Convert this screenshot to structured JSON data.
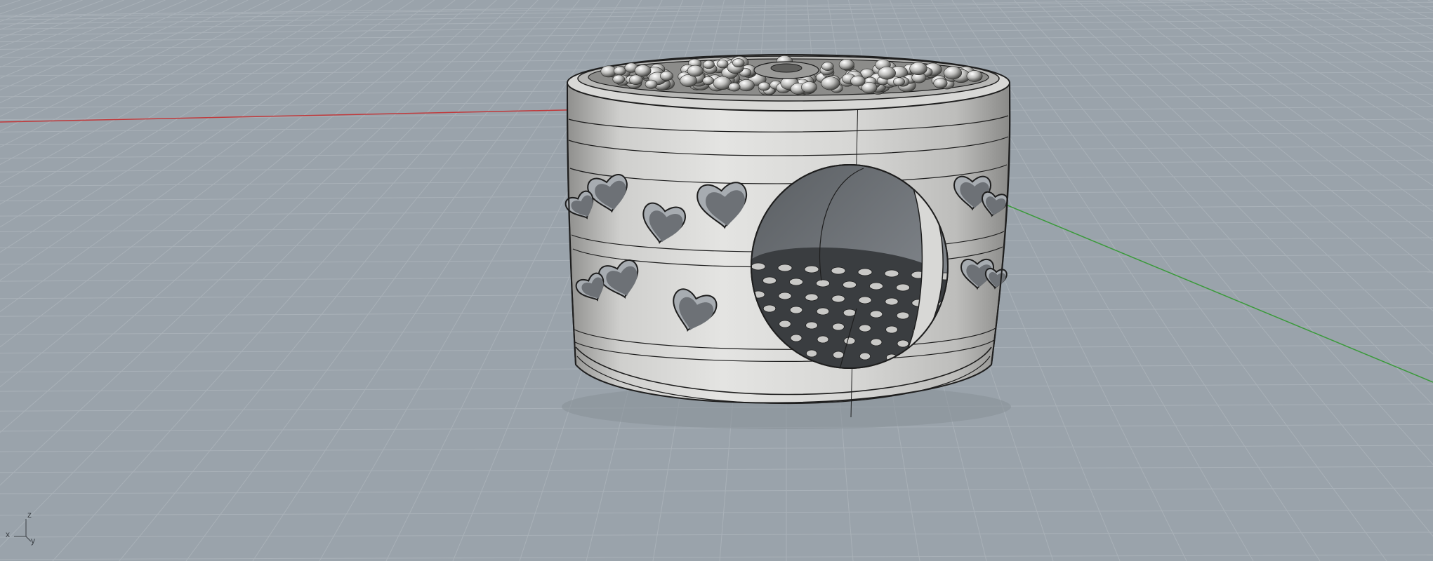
{
  "viewport": {
    "background_color": "#9aa3ab",
    "grid_color": "#a9b1b8",
    "x_axis_color": "#c0393b",
    "y_axis_color": "#3a9a3a"
  },
  "model": {
    "name": "ring-model",
    "body_color": "#c9c9c7",
    "edge_color": "#1e1e1e",
    "cutout_shape": "heart"
  },
  "axis_indicator": {
    "x_label": "x",
    "y_label": "y",
    "z_label": "z"
  }
}
